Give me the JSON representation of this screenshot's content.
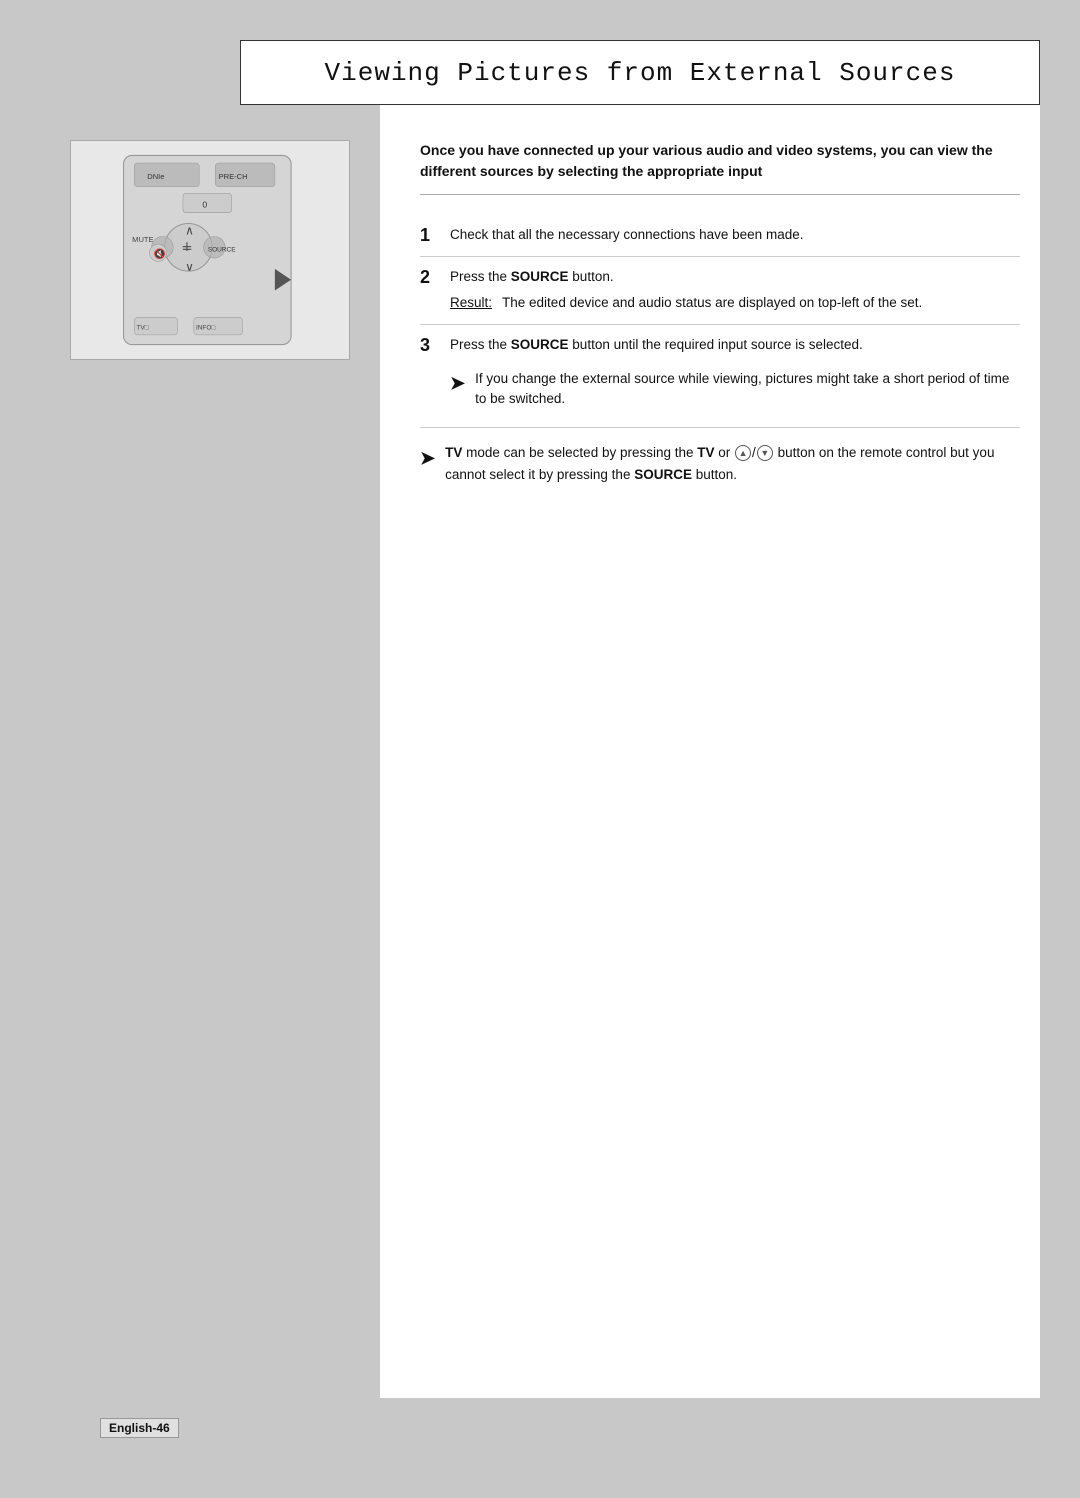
{
  "page": {
    "title": "Viewing Pictures from External Sources",
    "background_color": "#c8c8c8",
    "footer_label": "English-46"
  },
  "intro": {
    "text": "Once you have connected up your various audio and video systems, you can view the different sources by selecting the appropriate input"
  },
  "steps": [
    {
      "number": "1",
      "text": "Check that all the necessary connections have been made."
    },
    {
      "number": "2",
      "main_text_prefix": "Press the ",
      "main_text_bold": "SOURCE",
      "main_text_suffix": " button.",
      "result_label": "Result:",
      "result_text": "The edited device and audio status are displayed on top-left of the set."
    },
    {
      "number": "3",
      "main_text_prefix": "Press the ",
      "main_text_bold": "SOURCE",
      "main_text_suffix": " button until the required input source is selected.",
      "note_text": "If you change the external source while viewing, pictures might take a short period of time to be switched."
    }
  ],
  "tv_note": {
    "text_prefix": "TV mode can be selected by pressing the ",
    "tv_bold": "TV",
    "text_mid": " or ",
    "text_after_icons": " button on the remote control but you cannot select it by pressing the ",
    "source_bold": "SOURCE",
    "text_end": " button."
  },
  "arrow_symbol": "➤"
}
